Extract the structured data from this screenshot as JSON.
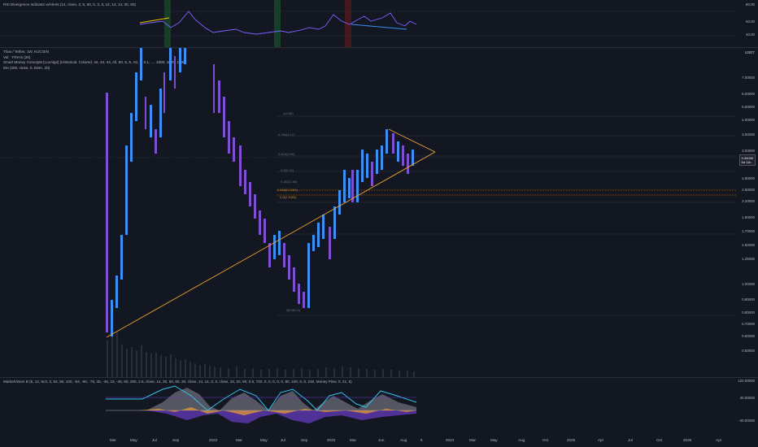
{
  "rsi_pane": {
    "title": "RSI Divergence Indicator w/Alerts (14, close, 3, 5, 60, 5, 3, 3, 14, 14, 14, 20, 80)",
    "axis_labels": [
      "80.00",
      "60.00",
      "40.00"
    ]
  },
  "main_pane": {
    "symbol_line": "Trias / Tether, 1W, KUCOIN",
    "vol_line": "Vol · TRIAS (20)",
    "smc_line": "Smart Money Concepts [LuxAlgo] (Historical, Colored, 44, 44, 44, All, 50, 5, 5, Atr, 3, 0.1, ..., 1000, 1000, 1000)",
    "ma_line": "MA (200, close, 0, EMA, 20)",
    "currency": "USDT",
    "price_axis": [
      "7.00000",
      "6.00000",
      "5.00000",
      "4.00000",
      "3.50000",
      "3.00000",
      "2.80000",
      "2.50000",
      "2.20000",
      "1.90000",
      "1.70000",
      "1.50000",
      "1.25000",
      "1.00000",
      "0.90000",
      "0.80000",
      "0.70000",
      "0.60000",
      "0.50000"
    ],
    "fib_levels": [
      "1(4.88)",
      "0.786(4.17)",
      "0.618(3.60)",
      "0.5(3.20)",
      "0.382(2.86)",
      "0.618(2.2081)",
      "0.5(2.2080)",
      "0(0.8674)"
    ],
    "current_price": "3.34035",
    "countdown": "5d 11h"
  },
  "mv_pane": {
    "title": "MarketVision B (9, 12, 9c3, 3, 53, 60, 100, -53, -60, -75, 45, -45, 15, -45, 60, 200, 2.5, close, 14, 30, 60, 60, 30, close, 14, 14, 3, 3, close, 10, 20, 50, 0.5, 720, 0, 0, 0, 0, 0, 80, 240, 0, 0, 240, Money Flow, 0, 21, 5)",
    "axis_labels": [
      "120.00000",
      "40.00000",
      "-40.00000"
    ]
  },
  "x_axis": [
    "Mar",
    "May",
    "Jul",
    "Sep",
    "2022",
    "Mar",
    "May",
    "Jul",
    "Sep",
    "2023",
    "Mar",
    "Jun",
    "Aug",
    "5",
    "2024",
    "Mar",
    "May",
    "Aug",
    "Oct",
    "2025",
    "Apr",
    "Jul",
    "Oct",
    "2026",
    "Apr"
  ],
  "colors": {
    "background": "#131722",
    "candle_up": "#3b8ff5",
    "candle_down": "#7e4fd1",
    "trendline": "#f0a030",
    "rsi_line": "#7b61ff",
    "grid": "#1f2330"
  }
}
